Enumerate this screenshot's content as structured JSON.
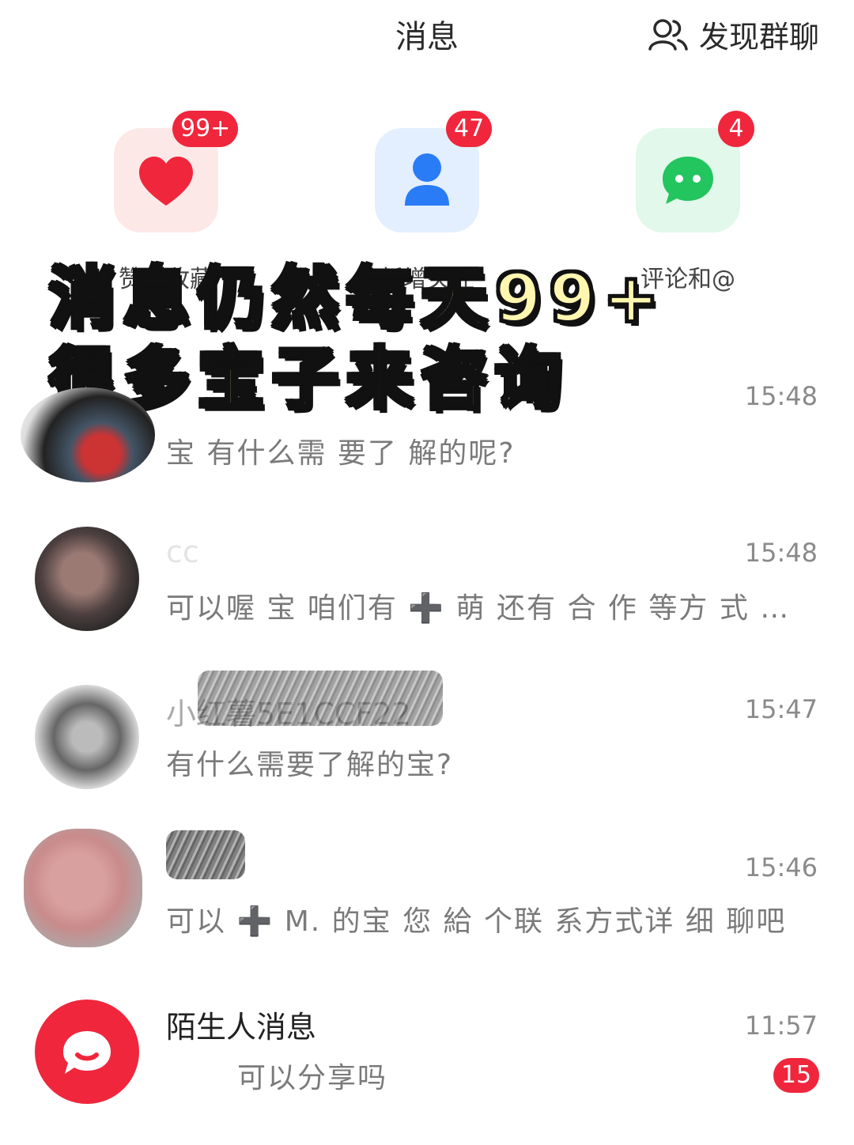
{
  "header": {
    "title": "消息",
    "discover_label": "发现群聊"
  },
  "categories": [
    {
      "label": "赞和收藏",
      "badge": "99+",
      "icon": "heart-icon",
      "color": "#f0263c"
    },
    {
      "label": "新增关注",
      "badge": "47",
      "icon": "person-icon",
      "color": "#2a7bf6"
    },
    {
      "label": "评论和@",
      "badge": "4",
      "icon": "chat-bubble-icon",
      "color": "#22c55e"
    }
  ],
  "overlay": {
    "line1": "消息仍然每天99+",
    "line2": "很多宝子来咨询"
  },
  "conversations": [
    {
      "name": "",
      "time": "15:48",
      "preview": "宝 有什么需 要了 解的呢?"
    },
    {
      "name": "cc",
      "time": "15:48",
      "preview": "可以喔 宝  咱们有 ➕ 萌  还有 合 作 等方 式  …"
    },
    {
      "name": "小红薯5E1CCF22",
      "time": "15:47",
      "preview": "有什么需要了解的宝?"
    },
    {
      "name": "",
      "time": "15:46",
      "preview": "可以 ➕  M. 的宝  您 給 个联  系方式详 细 聊吧"
    },
    {
      "name": "陌生人消息",
      "time": "11:57",
      "preview": "可以分享吗",
      "unread": "15"
    }
  ]
}
